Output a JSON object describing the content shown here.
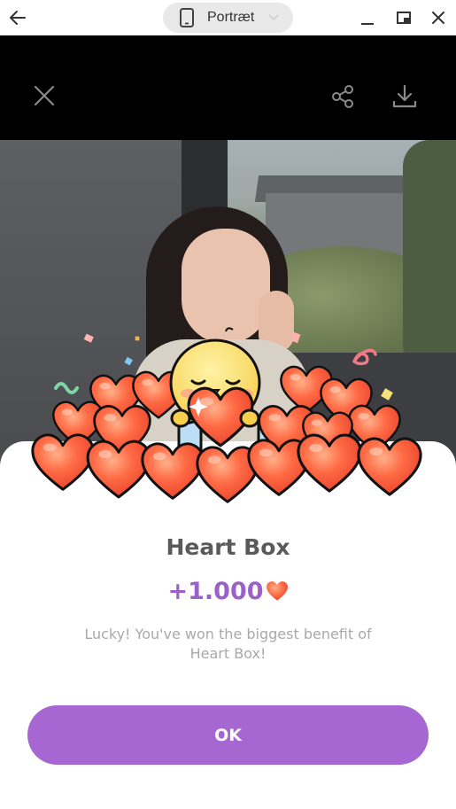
{
  "window": {
    "orientation_label": "Portræt",
    "icons": {
      "back": "arrow-left-icon",
      "phone": "phone-portrait-icon",
      "chevron": "chevron-down-icon",
      "minimize": "minimize-icon",
      "restore": "restore-window-icon",
      "close": "close-icon"
    }
  },
  "app_bar": {
    "icons": {
      "close": "close-icon",
      "share": "share-icon",
      "download": "download-icon"
    }
  },
  "reward": {
    "title": "Heart Box",
    "amount": "+1.000",
    "amount_icon": "heart-icon",
    "message": "Lucky! You've won the biggest benefit of Heart Box!",
    "ok_label": "OK"
  },
  "colors": {
    "accent": "#a667d2",
    "amount": "#9b61c9",
    "title": "#5a5a5a",
    "message": "#a9a9a9",
    "heart": "#f45b3b"
  }
}
